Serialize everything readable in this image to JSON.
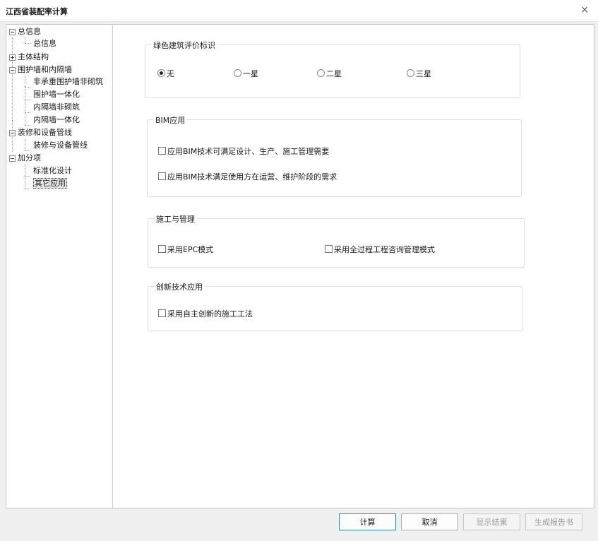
{
  "window": {
    "title": "江西省装配率计算",
    "close": "×"
  },
  "tree": {
    "items": [
      {
        "label": "总信息"
      },
      {
        "label": "总信息"
      },
      {
        "label": "主体结构"
      },
      {
        "label": "围护墙和内隔墙"
      },
      {
        "label": "非承重围护墙非砌筑"
      },
      {
        "label": "围护墙一体化"
      },
      {
        "label": "内隔墙非砌筑"
      },
      {
        "label": "内隔墙一体化"
      },
      {
        "label": "装修和设备管线"
      },
      {
        "label": "装修与设备管线"
      },
      {
        "label": "加分项"
      },
      {
        "label": "标准化设计"
      },
      {
        "label": "其它应用"
      }
    ]
  },
  "green_rating": {
    "title": "绿色建筑评价标识",
    "options": [
      "无",
      "一星",
      "二星",
      "三星"
    ],
    "selected": "无"
  },
  "bim": {
    "title": "BIM应用",
    "options": [
      "应用BIM技术可满足设计、生产、施工管理需要",
      "应用BIM技术满足使用方在运营、维护阶段的需求"
    ]
  },
  "construction": {
    "title": "施工与管理",
    "options": [
      "采用EPC模式",
      "采用全过程工程咨询管理模式"
    ]
  },
  "innovation": {
    "title": "创新技术应用",
    "options": [
      "采用自主创新的施工工法"
    ]
  },
  "buttons": {
    "calculate": "计算",
    "cancel": "取消",
    "show_result": "显示结果",
    "generate_report": "生成报告书"
  }
}
